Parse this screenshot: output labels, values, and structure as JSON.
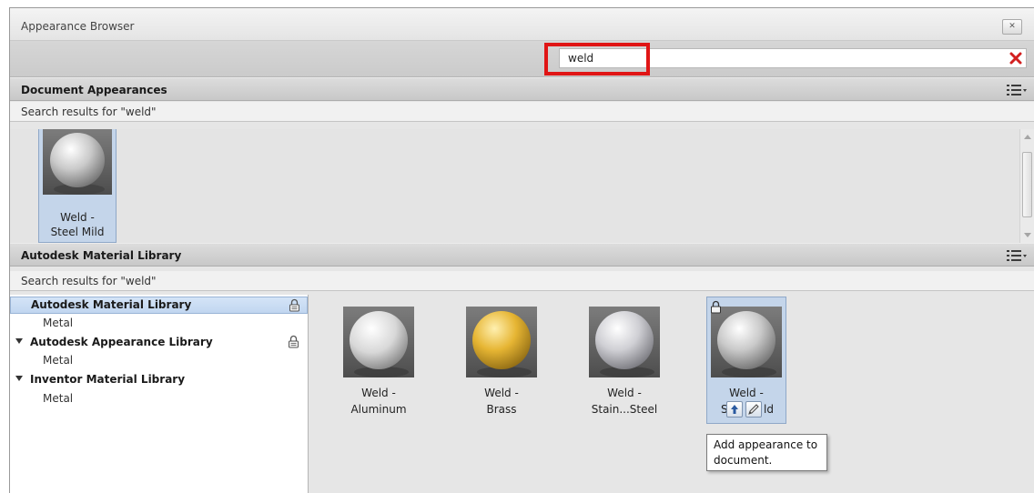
{
  "window": {
    "title": "Appearance Browser"
  },
  "search": {
    "value": "weld",
    "placeholder": ""
  },
  "document_appearances": {
    "title": "Document Appearances",
    "results_label": "Search results for \"weld\"",
    "items": [
      {
        "line1": "Weld -",
        "line2": "Steel Mild",
        "material": "steel"
      }
    ]
  },
  "material_library": {
    "title": "Autodesk Material Library",
    "results_label": "Search results for \"weld\"",
    "tree": [
      {
        "label": "Autodesk Material Library",
        "child": "Metal",
        "selected": true,
        "locked": true
      },
      {
        "label": "Autodesk Appearance Library",
        "child": "Metal",
        "selected": false,
        "locked": true
      },
      {
        "label": "Inventor Material Library",
        "child": "Metal",
        "selected": false,
        "locked": false
      }
    ],
    "items": [
      {
        "line1": "Weld -",
        "line2": "Aluminum",
        "material": "aluminum"
      },
      {
        "line1": "Weld -",
        "line2": "Brass",
        "material": "brass"
      },
      {
        "line1": "Weld -",
        "line2": "Stain...Steel",
        "material": "stainless"
      },
      {
        "line1": "Weld -",
        "line2_prefix": "S",
        "line2_suffix": "ld",
        "material": "steel",
        "selected": true,
        "locked": true
      }
    ]
  },
  "tooltip": {
    "line1": "Add appearance to",
    "line2": "document."
  },
  "icons": {
    "close": "close-icon",
    "clear_search": "clear-search-icon",
    "list_view": "list-view-icon",
    "lock": "lock-icon",
    "add_to_document": "add-to-document-icon",
    "edit": "edit-icon"
  },
  "colors": {
    "accent_highlight": "#e01515",
    "clear_icon": "#d21f1f",
    "selection": "#c4d5ea"
  }
}
